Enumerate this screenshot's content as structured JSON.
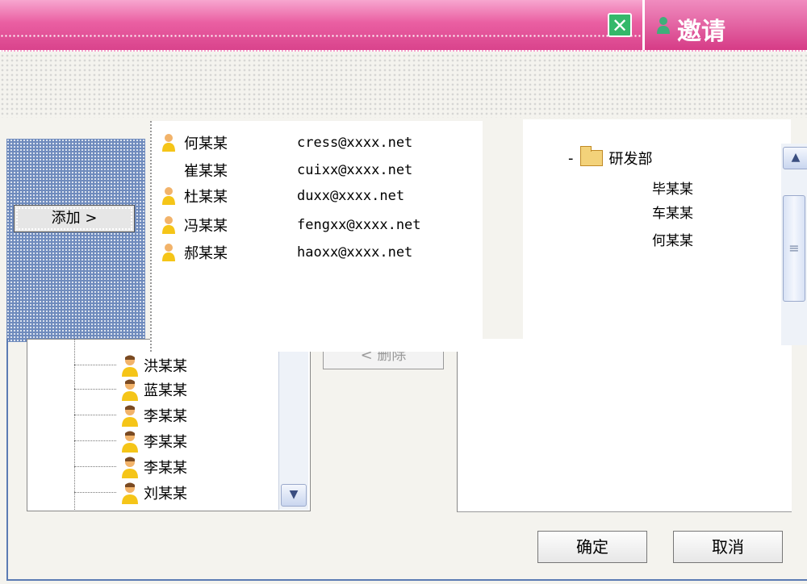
{
  "dialog": {
    "title": "邀请",
    "close_symbol": "✕"
  },
  "buttons": {
    "add": "添加 >",
    "delete": "< 删除",
    "ok": "确定",
    "cancel": "取消"
  },
  "popup_list": [
    {
      "name": "何某某",
      "email": "cress@xxxx.net"
    },
    {
      "name": "崔某某",
      "email": "cuixx@xxxx.net"
    },
    {
      "name": "杜某某",
      "email": "duxx@xxxx.net"
    },
    {
      "name": "冯某某",
      "email": "fengxx@xxxx.net"
    },
    {
      "name": "郝某某",
      "email": "haoxx@xxxx.net"
    }
  ],
  "left_tree": [
    "洪某某",
    "蓝某某",
    "李某某",
    "李某某",
    "李某某",
    "刘某某"
  ],
  "right_tree": {
    "folder": "研发部",
    "expander": "-",
    "members": [
      "毕某某",
      "车某某",
      "何某某"
    ]
  },
  "icons": {
    "close": "close-icon",
    "user": "user-icon",
    "person": "person-icon",
    "folder": "folder-icon",
    "scroll_up": "chevron-up-icon",
    "scroll_down": "chevron-down-icon"
  },
  "colors": {
    "title_bar": "#e85fa0",
    "close_button": "#34b86a",
    "left_panel": "#6f8bbd"
  }
}
